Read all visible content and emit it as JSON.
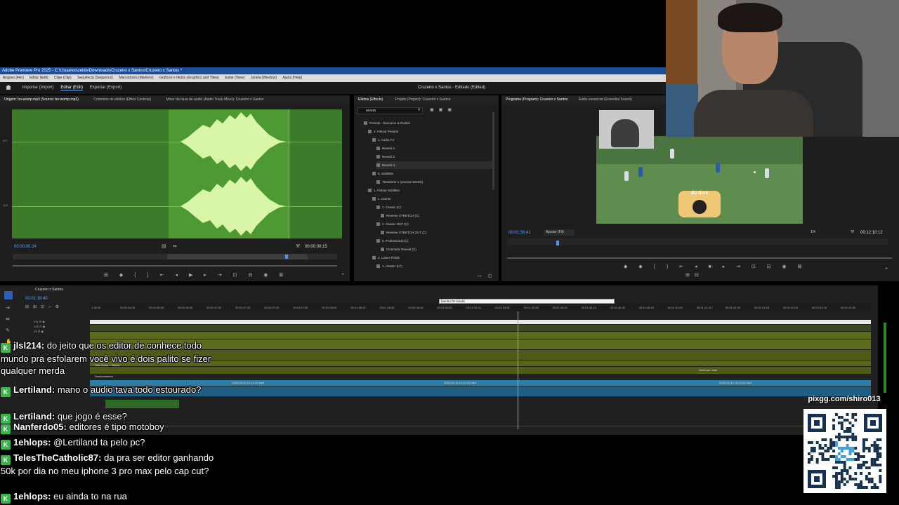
{
  "titlebar": {
    "title": "Adobe Premiere Pro 2025 - C:\\Usuarios\\zelde\\Downloads\\Cruzeiro x Santos\\Cruzeiro x Santos *"
  },
  "menu": [
    "Arquivo (File)",
    "Editar (Edit)",
    "Clipe (Clip)",
    "Sequência (Sequence)",
    "Marcadores (Markers)",
    "Gráficos e títulos (Graphics and Titles)",
    "Exibir (View)",
    "Janela (Window)",
    "Ajuda (Help)"
  ],
  "workspace": {
    "tabs": [
      "Importar (Import)",
      "Editar (Edit)",
      "Exportar (Export)"
    ],
    "active": "Editar (Edit)",
    "center_title": "Cruzeiro x Santos - Editado (Edited)"
  },
  "source_panel": {
    "tabs": [
      "Origem: bo-womp.mp3 (Source: bo-womp.mp3)",
      "Controles de efeitos (Effect Controls)",
      "Mixer da faixa de áudio (Audio Track Mixer): Cruzeiro x Santos"
    ],
    "timecode": "00:00:00:24",
    "duration": "00:00:00:15",
    "scale": [
      "5.0",
      "0.0",
      "-5.0",
      "dB"
    ]
  },
  "effects_panel": {
    "tabs": [
      "Efeitos (Effects)",
      "Projeto (Project): Cruzeiro x Santos"
    ],
    "search": "reverb",
    "tree": [
      {
        "label": "Presets - Resource & Rookie",
        "indent": 1
      },
      {
        "label": "1. Finisar Presets",
        "indent": 2
      },
      {
        "label": "1. Audio FX",
        "indent": 3
      },
      {
        "label": "Reverb 1",
        "indent": 4
      },
      {
        "label": "Reverb 2",
        "indent": 4
      },
      {
        "label": "Reverb 3",
        "indent": 4
      },
      {
        "label": "6. Subtitles",
        "indent": 3
      },
      {
        "label": "Transform 1 (reverse stretch)",
        "indent": 4
      },
      {
        "label": "1. Finisar Subtitles",
        "indent": 2
      },
      {
        "label": "1. Carrier",
        "indent": 3
      },
      {
        "label": "1. Classic (C)",
        "indent": 4
      },
      {
        "label": "Reverse STRETCH (C)",
        "indent": 5
      },
      {
        "label": "1. Classic OUT (C)",
        "indent": 4
      },
      {
        "label": "Reverse STRETCH OUT (C)",
        "indent": 5
      },
      {
        "label": "5. Professional (C)",
        "indent": 4
      },
      {
        "label": "Cinematic Reveal (C)",
        "indent": 5
      },
      {
        "label": "2. Lower Thirds",
        "indent": 3
      },
      {
        "label": "1. Classic (LT)",
        "indent": 4
      }
    ]
  },
  "program_panel": {
    "tabs": [
      "Programa (Program): Cruzeiro x Santos",
      "Áudio essencial (Essential Sound)"
    ],
    "timecode": "00:01:39:41",
    "fit": "Ajustar (Fit)",
    "ratio": "1/4",
    "duration": "00:12:10:12",
    "overlay_text": "do time"
  },
  "timeline": {
    "tab": "Cruzeiro x Santos",
    "timecode": "00:01:39:40",
    "marker": "bambo hit reverb",
    "ticks": [
      "1:36:00",
      "00:01:36:15",
      "00:01:36:30",
      "00:01:36:45",
      "00:01:37:00",
      "00:01:37:15",
      "00:01:37:30",
      "00:01:37:45",
      "00:01:38:00",
      "00:01:38:15",
      "00:01:38:30",
      "00:01:38:45",
      "00:01:39:00",
      "00:01:39:15",
      "00:01:39:30",
      "00:01:39:45",
      "00:01:40:00",
      "00:01:40:15",
      "00:01:40:30",
      "00:01:40:45",
      "00:01:41:00",
      "00:01:41:15",
      "00:01:41:30",
      "00:01:41:45",
      "00:01:42:00",
      "00:01:42:15",
      "00:01:42:30"
    ],
    "tracks": [
      "V11",
      "V10",
      "V9"
    ],
    "clip_labels": [
      "WebCam Jean",
      "2025-08-10 19-19-34.mp4",
      "2025-08-10 19-19-34.mp4",
      "2025-08-10 19-19-34.mp4",
      "Tela Cheia + Tabela",
      "Desfocamento"
    ]
  },
  "chat": [
    {
      "user": "jlsl214:",
      "message": "do jeito que os editor de conhece todo mundo pra esfolarem você vivo é dois palito se fizer qualquer merda"
    },
    {
      "user": "Lertiland:",
      "message": "mano o audio tava todo estourado?"
    },
    {
      "user": "Lertiland:",
      "message": "que jogo é esse?"
    },
    {
      "user": "Nanferdo05:",
      "message": "editores é tipo motoboy"
    },
    {
      "user": "1ehlops:",
      "message": "@Lertiland ta pelo pc?"
    },
    {
      "user": "TelesTheCatholic87:",
      "message": "da pra ser editor ganhando 50k por dia no meu iphone 3 pro max pelo cap cut?"
    },
    {
      "user": "1ehlops:",
      "message": "eu ainda to na rua"
    }
  ],
  "qr": {
    "url": "pixgg.com/shiro013"
  },
  "colors": {
    "waveform": "#3c7b2a",
    "accent": "#5aa0ff",
    "chat_badge": "#3bb44a"
  }
}
